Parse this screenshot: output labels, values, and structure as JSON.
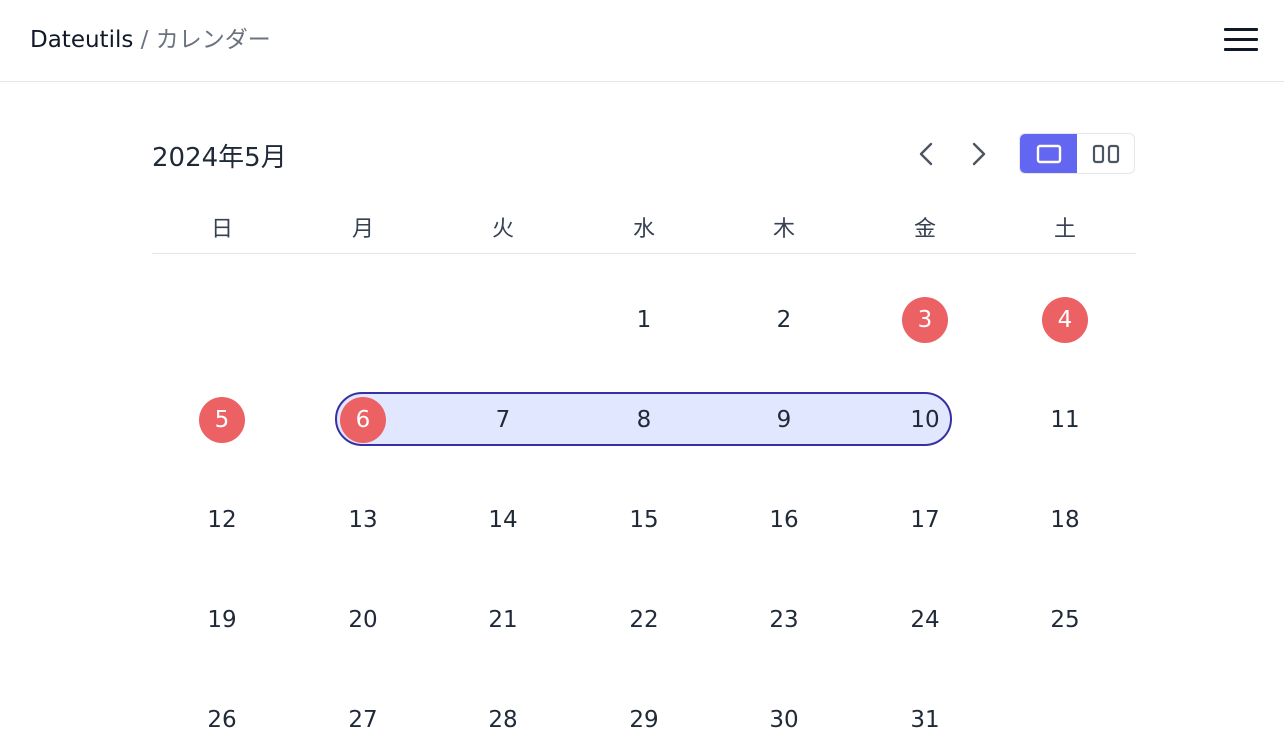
{
  "header": {
    "app_name": "Dateutils",
    "separator": "/",
    "page_name": "カレンダー",
    "menu_icon": "hamburger-menu-icon"
  },
  "calendar": {
    "month_title": "2024年5月",
    "prev_icon": "chevron-left-icon",
    "next_icon": "chevron-right-icon",
    "view_modes": [
      {
        "icon": "single-month-icon",
        "active": true
      },
      {
        "icon": "two-month-icon",
        "active": false
      }
    ],
    "weekdays": [
      "日",
      "月",
      "火",
      "水",
      "木",
      "金",
      "土"
    ],
    "weeks": [
      [
        "",
        "",
        "",
        "1",
        "2",
        "3",
        "4"
      ],
      [
        "5",
        "6",
        "7",
        "8",
        "9",
        "10",
        "11"
      ],
      [
        "12",
        "13",
        "14",
        "15",
        "16",
        "17",
        "18"
      ],
      [
        "19",
        "20",
        "21",
        "22",
        "23",
        "24",
        "25"
      ],
      [
        "26",
        "27",
        "28",
        "29",
        "30",
        "31",
        ""
      ]
    ],
    "holidays": [
      "3",
      "4",
      "5",
      "6"
    ],
    "selected_range": {
      "start": "6",
      "end": "10"
    },
    "colors": {
      "accent": "#6366f1",
      "holiday": "#ec6164",
      "range_fill": "#e0e7ff",
      "range_border": "#3730a3"
    }
  }
}
